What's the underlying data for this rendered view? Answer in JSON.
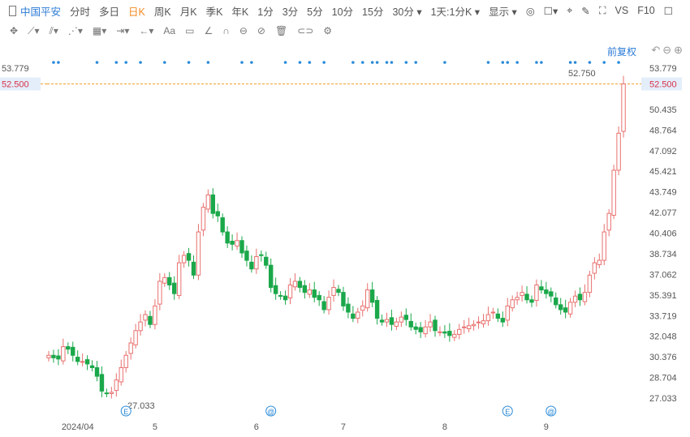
{
  "toolbar": {
    "stock": "中国平安",
    "periods": [
      "分时",
      "多日",
      "日K",
      "周K",
      "月K",
      "季K",
      "年K",
      "1分",
      "3分",
      "5分",
      "10分",
      "15分",
      "30分 ▾",
      "1天:1分K ▾"
    ],
    "active": "日K",
    "display": "显示 ▾",
    "right": [
      "◎",
      "☐▾",
      "⌖",
      "✎",
      "⛶",
      "VS",
      "F10",
      "☐"
    ]
  },
  "drawtools": [
    "✥",
    "⟋▾",
    "⫽▾",
    "⋰▾",
    "▦▾",
    "⇥▾",
    "←▾",
    "Aa",
    "▭",
    "∠",
    "∩",
    "⊖",
    "⊘",
    "🗑",
    "⊂⊃",
    "⚙"
  ],
  "adjust_label": "前复权",
  "zoom_controls": "↶⊖⊕",
  "current_price": "52.500",
  "high_label": "52.750",
  "low_label": "27.033",
  "colors": {
    "up": "#e8716f",
    "down": "#1aa84a",
    "dash": "#f0a030",
    "dots": "#2a8ad8"
  },
  "chart_data": {
    "type": "candlestick",
    "ylim": [
      27.033,
      53.779
    ],
    "yticks": [
      "53.779",
      "52.500",
      "50.435",
      "48.764",
      "47.092",
      "45.421",
      "43.749",
      "42.077",
      "40.406",
      "38.734",
      "37.062",
      "35.391",
      "33.719",
      "32.048",
      "30.376",
      "28.704",
      "27.033"
    ],
    "xticks": [
      {
        "label": "2024/04",
        "i": 6
      },
      {
        "label": "5",
        "i": 22
      },
      {
        "label": "6",
        "i": 43
      },
      {
        "label": "7",
        "i": 61
      },
      {
        "label": "8",
        "i": 82
      },
      {
        "label": "9",
        "i": 103
      }
    ],
    "closes": [
      30.5,
      30.3,
      30.2,
      31.2,
      31.0,
      30.5,
      30.0,
      30.0,
      29.8,
      29.5,
      28.8,
      27.6,
      27.4,
      27.5,
      28.5,
      29.5,
      30.5,
      31.5,
      32.5,
      33.2,
      33.8,
      33.0,
      34.5,
      36.5,
      36.8,
      36.2,
      35.5,
      38.0,
      38.6,
      38.2,
      37.0,
      40.5,
      42.5,
      43.5,
      42.0,
      41.8,
      40.5,
      39.6,
      39.5,
      39.8,
      38.8,
      38.2,
      37.5,
      38.5,
      38.6,
      37.8,
      36.0,
      35.5,
      35.3,
      35.0,
      36.2,
      36.5,
      36.0,
      35.6,
      35.8,
      35.2,
      35.0,
      34.2,
      35.2,
      36.0,
      35.6,
      34.5,
      34.0,
      33.5,
      34.0,
      34.5,
      35.8,
      34.8,
      33.5,
      33.2,
      33.4,
      33.0,
      33.2,
      33.6,
      33.4,
      32.8,
      32.6,
      32.4,
      32.8,
      33.2,
      32.5,
      32.4,
      32.3,
      32.1,
      32.2,
      32.6,
      32.8,
      32.9,
      33.0,
      33.2,
      33.3,
      33.8,
      34.0,
      33.5,
      33.2,
      34.5,
      35.0,
      35.2,
      35.6,
      35.0,
      34.8,
      36.2,
      35.8,
      35.5,
      35.3,
      34.6,
      34.2,
      34.0,
      34.8,
      35.3,
      35.0,
      35.6,
      37.0,
      38.0,
      38.2,
      40.5,
      42.0,
      45.5,
      48.5,
      52.5
    ],
    "dot_indices": [
      1,
      2,
      10,
      14,
      16,
      19,
      24,
      29,
      33,
      40,
      42,
      49,
      52,
      54,
      57,
      63,
      65,
      67,
      68,
      70,
      71,
      74,
      76,
      82,
      91,
      94,
      95,
      97,
      101,
      102,
      108,
      109,
      112,
      115,
      118
    ],
    "events": [
      {
        "label": "E",
        "i": 16
      },
      {
        "label": "@",
        "i": 46
      },
      {
        "label": "E",
        "i": 95
      },
      {
        "label": "@",
        "i": 104
      }
    ]
  }
}
